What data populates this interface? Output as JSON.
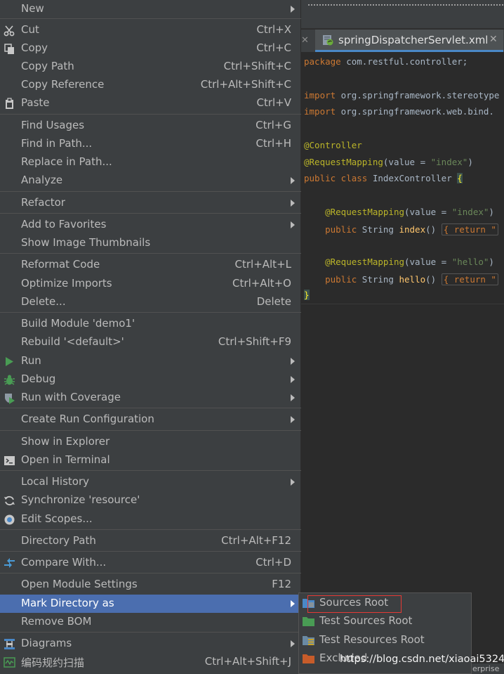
{
  "editor": {
    "tab": {
      "label": "springDispatcherServlet.xml",
      "close": "✕"
    },
    "tab_close_left": "✕",
    "code": {
      "l1": {
        "kw": "package",
        "rest": " com.restful.controller;"
      },
      "l2": {
        "kw": "import",
        "rest": " org.springframework.stereotype"
      },
      "l3": {
        "kw": "import",
        "rest": " org.springframework.web.bind."
      },
      "l4": {
        "an": "@Controller"
      },
      "l5": {
        "an": "@RequestMapping",
        "a": "(value = ",
        "st": "\"index\"",
        "b": ")"
      },
      "l6": {
        "kw": "public class",
        "rest": " IndexController ",
        "brace": "{"
      },
      "l7": {
        "an": "@RequestMapping",
        "a": "(value = ",
        "st": "\"index\"",
        "b": ")"
      },
      "l8": {
        "kw": "public",
        "a": " String ",
        "fn": "index",
        "b": "() ",
        "fold": "{ return \""
      },
      "l9": {
        "an": "@RequestMapping",
        "a": "(value = ",
        "st": "\"hello\"",
        "b": ")"
      },
      "l10": {
        "kw": "public",
        "a": " String ",
        "fn": "hello",
        "b": "() ",
        "fold": "{ return \""
      },
      "l11": {
        "brace": "}"
      }
    },
    "bottom_fragment": "erprise"
  },
  "menu": {
    "items": [
      {
        "label": "New",
        "arrow": true
      },
      {
        "label": "Cut",
        "shortcut": "Ctrl+X",
        "icon": "scissors-icon"
      },
      {
        "label": "Copy",
        "shortcut": "Ctrl+C",
        "icon": "copy-icon"
      },
      {
        "label": "Copy Path",
        "shortcut": "Ctrl+Shift+C"
      },
      {
        "label": "Copy Reference",
        "shortcut": "Ctrl+Alt+Shift+C"
      },
      {
        "label": "Paste",
        "shortcut": "Ctrl+V",
        "icon": "clipboard-icon"
      },
      {
        "label": "Find Usages",
        "shortcut": "Ctrl+G"
      },
      {
        "label": "Find in Path...",
        "shortcut": "Ctrl+H"
      },
      {
        "label": "Replace in Path..."
      },
      {
        "label": "Analyze",
        "arrow": true
      },
      {
        "label": "Refactor",
        "arrow": true
      },
      {
        "label": "Add to Favorites",
        "arrow": true
      },
      {
        "label": "Show Image Thumbnails"
      },
      {
        "label": "Reformat Code",
        "shortcut": "Ctrl+Alt+L"
      },
      {
        "label": "Optimize Imports",
        "shortcut": "Ctrl+Alt+O"
      },
      {
        "label": "Delete...",
        "shortcut": "Delete"
      },
      {
        "label": "Build Module 'demo1'"
      },
      {
        "label": "Rebuild '<default>'",
        "shortcut": "Ctrl+Shift+F9"
      },
      {
        "label": "Run",
        "arrow": true,
        "icon": "run-icon"
      },
      {
        "label": "Debug",
        "arrow": true,
        "icon": "debug-icon"
      },
      {
        "label": "Run with Coverage",
        "arrow": true,
        "icon": "coverage-icon"
      },
      {
        "label": "Create Run Configuration",
        "arrow": true
      },
      {
        "label": "Show in Explorer"
      },
      {
        "label": "Open in Terminal",
        "icon": "terminal-icon"
      },
      {
        "label": "Local History",
        "arrow": true
      },
      {
        "label": "Synchronize 'resource'",
        "icon": "sync-icon"
      },
      {
        "label": "Edit Scopes...",
        "icon": "scope-icon"
      },
      {
        "label": "Directory Path",
        "shortcut": "Ctrl+Alt+F12"
      },
      {
        "label": "Compare With...",
        "shortcut": "Ctrl+D",
        "icon": "compare-icon"
      },
      {
        "label": "Open Module Settings",
        "shortcut": "F12"
      },
      {
        "label": "Mark Directory as",
        "arrow": true,
        "selected": true
      },
      {
        "label": "Remove BOM"
      },
      {
        "label": "Diagrams",
        "arrow": true,
        "icon": "diagram-icon"
      },
      {
        "label": "编码规约扫描",
        "shortcut": "Ctrl+Alt+Shift+J",
        "icon": "scan-icon"
      }
    ]
  },
  "submenu": {
    "items": [
      {
        "label": "Sources Root",
        "icon": "sources-root-folder-icon",
        "color": "#4a88c7"
      },
      {
        "label": "Test Sources Root",
        "icon": "test-sources-folder-icon",
        "color": "#499c54"
      },
      {
        "label": "Test Resources Root",
        "icon": "test-resources-folder-icon",
        "color": "#6a8aa4"
      },
      {
        "label": "Excluded",
        "icon": "excluded-folder-icon",
        "color": "#c75c2a"
      }
    ]
  },
  "watermark": "https://blog.csdn.net/xiaoai5324",
  "colors": {
    "selection": "#4b6eaf",
    "menu_bg": "#3c3f41",
    "text": "#bbbbbb",
    "highlight_box": "#e53935"
  }
}
